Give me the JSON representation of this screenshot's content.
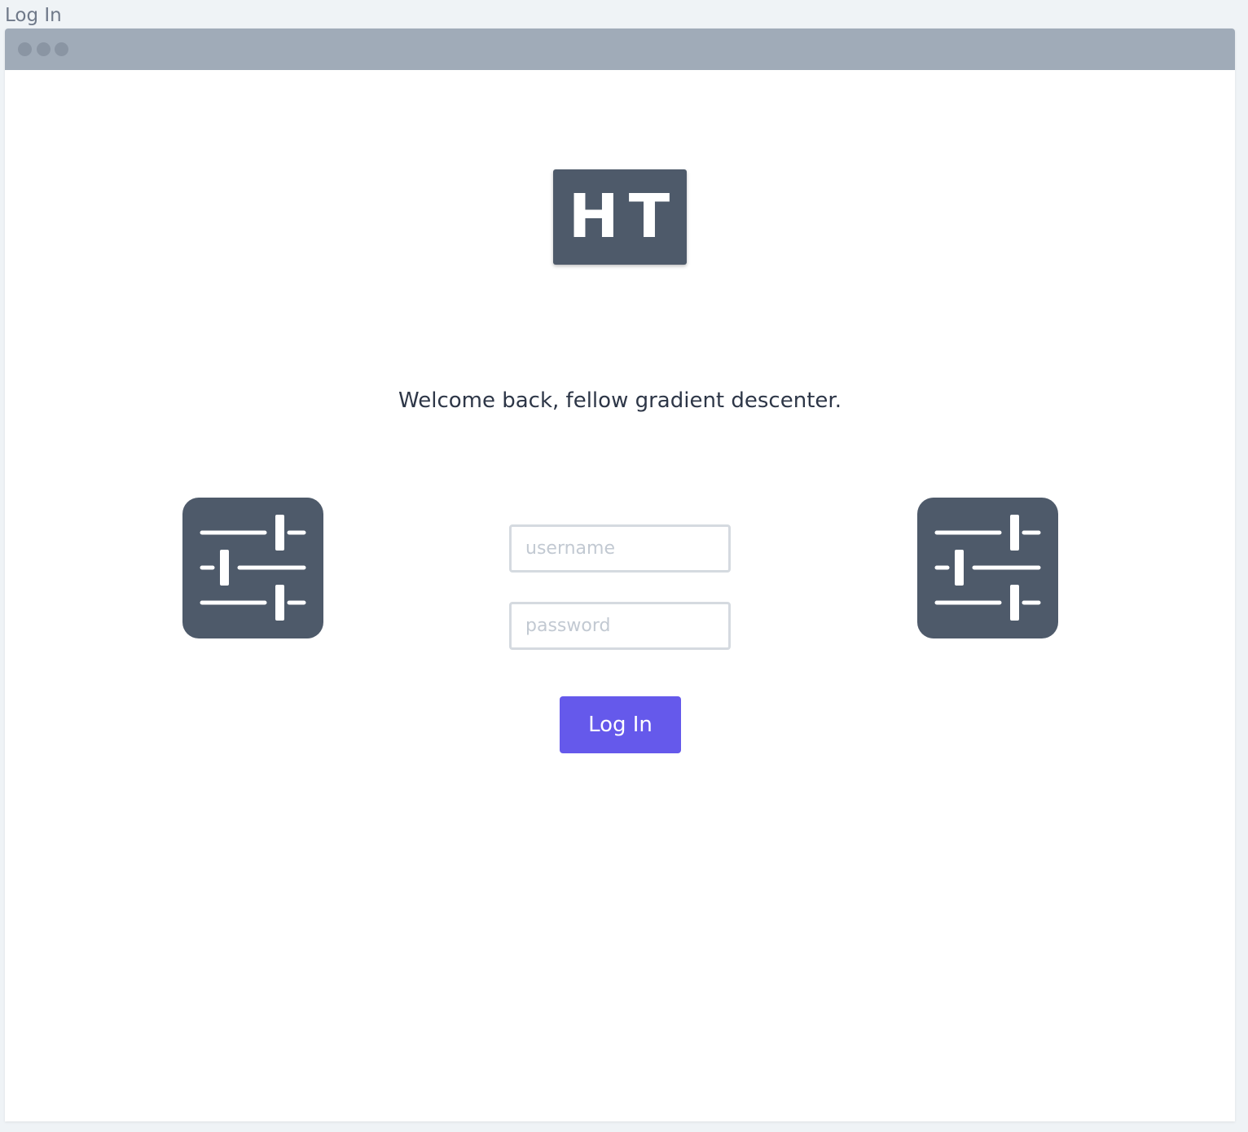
{
  "page": {
    "title": "Log In"
  },
  "window": {
    "titlebar_controls": [
      "window-dot-icon",
      "window-dot-icon",
      "window-dot-icon"
    ]
  },
  "logo": {
    "text": "HT"
  },
  "welcome": {
    "message": "Welcome back, fellow gradient descenter."
  },
  "decor": {
    "left_icon": "sliders-icon",
    "right_icon": "sliders-icon"
  },
  "form": {
    "username": {
      "placeholder": "username",
      "value": ""
    },
    "password": {
      "placeholder": "password",
      "value": ""
    },
    "submit_label": "Log In"
  },
  "colors": {
    "accent": "#6559eb",
    "tile": "#4e5a6a",
    "titlebar": "#a0abb8",
    "background": "#eff3f6",
    "text": "#2d3647"
  }
}
